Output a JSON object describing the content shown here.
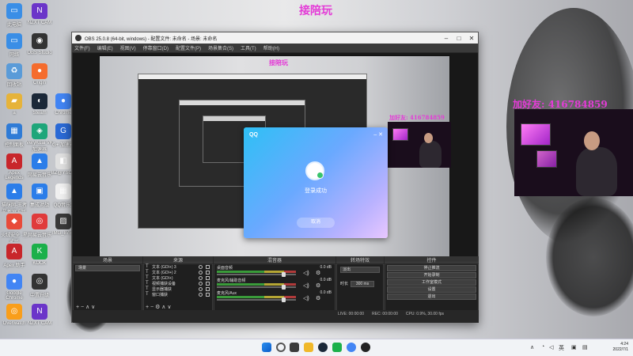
{
  "overlay": {
    "title_cn": "接陪玩",
    "title_cn_small": "接陪玩",
    "qq_label": "加好友: 416784859",
    "qq_label_small": "加好友: 416784859"
  },
  "desktop_icons": [
    {
      "label": "此电脑",
      "name": "this-pc",
      "color": "#3a8ee6",
      "glyph": "▭"
    },
    {
      "label": "网络",
      "name": "network",
      "color": "#3a8ee6",
      "glyph": "▭"
    },
    {
      "label": "回收站",
      "name": "recycle-bin",
      "color": "#5a9bd8",
      "glyph": "♻"
    },
    {
      "label": "a",
      "name": "folder-a",
      "color": "#e6b33a",
      "glyph": "▰"
    },
    {
      "label": "控制面板",
      "name": "control-panel",
      "color": "#2f7bd6",
      "glyph": "▦"
    },
    {
      "label": "Apex Legends",
      "name": "apex-legends",
      "color": "#c8262b",
      "glyph": "A"
    },
    {
      "label": "猫咪网-王者最新官方版",
      "name": "cat-app",
      "color": "#2b7de9",
      "glyph": "▲"
    },
    {
      "label": "火绒安全 ·星戒版",
      "name": "huorong",
      "color": "#e84b3a",
      "glyph": "◆"
    },
    {
      "label": "Apex 助手",
      "name": "apex-helper",
      "color": "#c8262b",
      "glyph": "A"
    },
    {
      "label": "Google Chrome",
      "name": "chrome",
      "color": "#4285f4",
      "glyph": "●"
    },
    {
      "label": "Overwatch",
      "name": "overwatch",
      "color": "#f99e1a",
      "glyph": "◎"
    },
    {
      "label": "NZXT CAM",
      "name": "nzxt-cam",
      "color": "#6b35c9",
      "glyph": "N"
    },
    {
      "label": "OBS Studio",
      "name": "obs-studio",
      "color": "#333",
      "glyph": "◉"
    },
    {
      "label": "Origin",
      "name": "origin",
      "color": "#f56c2d",
      "glyph": "●"
    },
    {
      "label": "Steam",
      "name": "steam",
      "color": "#1b2838",
      "glyph": "◐"
    },
    {
      "label": "VeryKuai VK 加速器",
      "name": "verykuai",
      "color": "#1ea67a",
      "glyph": "◈"
    },
    {
      "label": "网易云音乐",
      "name": "netease-music",
      "color": "#2b7de9",
      "glyph": "▲"
    },
    {
      "label": "集成对战",
      "name": "battle-app",
      "color": "#2b7de9",
      "glyph": "▣"
    },
    {
      "label": "网易云音乐",
      "name": "netease-cloud",
      "color": "#e03b3b",
      "glyph": "◎"
    },
    {
      "label": "KOOK",
      "name": "kook",
      "color": "#1bb04a",
      "glyph": "K"
    },
    {
      "label": "中置升级",
      "name": "upgrade",
      "color": "#333",
      "glyph": "◎"
    },
    {
      "label": "NZXT CAM",
      "name": "nzxt-cam-2",
      "color": "#6b35c9",
      "glyph": "N"
    },
    {
      "label": "Chrome",
      "name": "chrome-2",
      "color": "#4285f4",
      "glyph": "●"
    },
    {
      "label": "G+ 加速器",
      "name": "g-plus",
      "color": "#2b6ad6",
      "glyph": "G"
    },
    {
      "label": "BZ@YSOS",
      "name": "bz-ysos",
      "color": "#e0e0e0",
      "glyph": "◧"
    },
    {
      "label": "QQ音乐2",
      "name": "qq-music",
      "color": "#f0f0f0",
      "glyph": "▦"
    },
    {
      "label": "IMG_8758",
      "name": "img-file",
      "color": "#3a3a3a",
      "glyph": "▨"
    }
  ],
  "obs": {
    "title": "OBS 25.0.8 (64-bit, windows) - 配置文件: 未命名 - 场景: 未命名",
    "menu": [
      "文件(F)",
      "编辑(E)",
      "视图(V)",
      "停靠窗口(D)",
      "配置文件(P)",
      "场景集合(S)",
      "工具(T)",
      "帮助(H)"
    ],
    "docks": {
      "scenes": "场景",
      "sources": "来源",
      "mixer": "混音器",
      "transitions": "转场特效",
      "controls": "控件"
    },
    "scene_items": [
      "场景"
    ],
    "source_items": [
      "文本 (GDI+) 3",
      "文本 (GDI+) 2",
      "文本 (GDI+)",
      "视频捕获设备",
      "显示器捕获",
      "窗口捕获"
    ],
    "mixer": [
      {
        "label": "桌面音频",
        "db": "0.0 dB"
      },
      {
        "label": "麦克风/辅助音频",
        "db": "0.0 dB"
      },
      {
        "label": "麦克风/Aux",
        "db": "0.0 dB"
      }
    ],
    "transition": {
      "type": "淡出",
      "duration_label": "时长",
      "duration": "300 ms"
    },
    "controls": [
      "停止推流",
      "开始录制",
      "工作室模式",
      "设置",
      "退出"
    ],
    "status": {
      "live": "LIVE: 00:00:00",
      "rec": "REC: 00:00:00",
      "cpu": "CPU: 0.9%, 30.00 fps"
    }
  },
  "qq": {
    "logo": "QQ",
    "status": "登录成功",
    "cancel": "取消"
  },
  "taskbar": {
    "lang": "英",
    "time": "4:24",
    "date": "2022/7/1"
  }
}
